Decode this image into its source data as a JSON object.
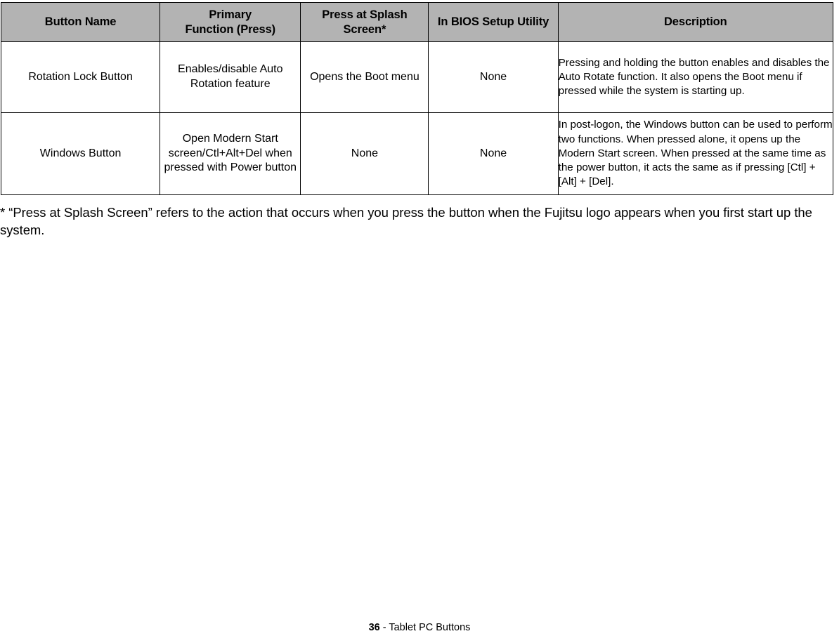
{
  "table": {
    "headers": [
      {
        "line1": "Button Name",
        "line2": ""
      },
      {
        "line1": "Primary",
        "line2": "Function (Press)"
      },
      {
        "line1": "Press at Splash",
        "line2": "Screen*"
      },
      {
        "line1": "In BIOS Setup Utility",
        "line2": ""
      },
      {
        "line1": "Description",
        "line2": ""
      }
    ],
    "rows": [
      {
        "name": "Rotation Lock Button",
        "primary_function": "Enables/disable Auto Rotation feature",
        "press_at_splash": "Opens the Boot menu",
        "in_bios": "None",
        "description": "Pressing and holding the button enables and disables the Auto Rotate function. It also opens the Boot menu if pressed while the system is starting up."
      },
      {
        "name": "Windows Button",
        "primary_function": "Open Modern Start screen/Ctl+Alt+Del when pressed with Power button",
        "press_at_splash": "None",
        "in_bios": "None",
        "description": "In post-logon, the Windows button can be used to perform two functions. When pressed alone, it opens up the Modern Start screen. When pressed at the same time as the power button, it acts the same as if pressing [Ctl] + [Alt] + [Del]."
      }
    ]
  },
  "footnote": "* “Press at Splash Screen” refers to the action that occurs when you press the button when the Fujitsu logo appears when you first start up the system.",
  "footer": {
    "page_number": "36",
    "separator": " - ",
    "section_title": "Tablet PC Buttons"
  },
  "colors": {
    "header_fill": "#b3b3b3",
    "border": "#000000",
    "text": "#000000",
    "page_background": "#ffffff"
  }
}
